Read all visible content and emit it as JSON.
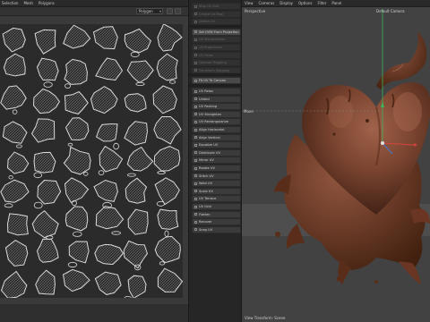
{
  "uv_editor": {
    "menu": [
      "Selection",
      "Mesh",
      "Polygons"
    ],
    "mode_select": "Polygon",
    "dropdown_chevron": "▾"
  },
  "tools": [
    {
      "label": "Ship UV Slot",
      "state": "dim"
    },
    {
      "label": "Create UV Map",
      "state": "dim"
    },
    {
      "label": "Delete UV",
      "state": "dim"
    },
    {
      "label": "Set UVW From Projection",
      "state": "bright"
    },
    {
      "label": "UV Manipulation",
      "state": "dim"
    },
    {
      "label": "UV Projections",
      "state": "dim"
    },
    {
      "label": "UV Relax",
      "state": "dim"
    },
    {
      "label": "Optimal Mapping",
      "state": "dim"
    },
    {
      "label": "Transform Mapping",
      "state": "dim"
    },
    {
      "label": "Fit UV To Canvas",
      "state": "bright"
    },
    {
      "label": "UV Relax",
      "state": "normal"
    },
    {
      "label": "Unfold",
      "state": "normal"
    },
    {
      "label": "UV Packing",
      "state": "normal"
    },
    {
      "label": "UV Straighten",
      "state": "normal"
    },
    {
      "label": "UV Rectangularize",
      "state": "normal"
    },
    {
      "label": "Align Horizontal",
      "state": "normal"
    },
    {
      "label": "Align Vertical",
      "state": "normal"
    },
    {
      "label": "Equalize UV",
      "state": "normal"
    },
    {
      "label": "Distribute UV",
      "state": "normal"
    },
    {
      "label": "Mirror UV",
      "state": "normal"
    },
    {
      "label": "Rotate UV",
      "state": "normal"
    },
    {
      "label": "Stitch UV",
      "state": "normal"
    },
    {
      "label": "Weld UV",
      "state": "normal"
    },
    {
      "label": "Scale UV",
      "state": "normal"
    },
    {
      "label": "UV Terrace",
      "state": "normal"
    },
    {
      "label": "UV Grid",
      "state": "normal"
    },
    {
      "label": "Flatten",
      "state": "normal"
    },
    {
      "label": "Recover",
      "state": "normal"
    },
    {
      "label": "Snap UV",
      "state": "normal"
    }
  ],
  "viewport": {
    "menu": [
      "View",
      "Cameras",
      "Display",
      "Options",
      "Filter",
      "Panel"
    ],
    "projection": "Perspective",
    "camera": "Default Camera",
    "move_label": "Move",
    "status": "View Transform: Scene"
  }
}
